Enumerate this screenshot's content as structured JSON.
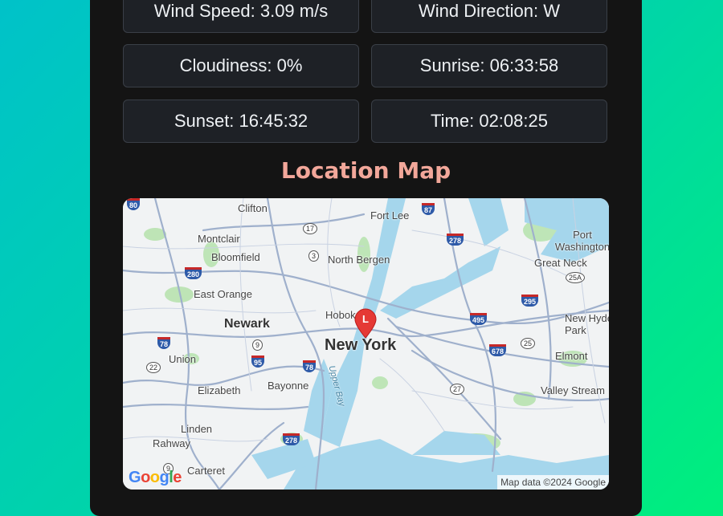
{
  "weather": {
    "wind_speed": "Wind Speed: 3.09 m/s",
    "wind_direction": "Wind Direction: W",
    "cloudiness": "Cloudiness: 0%",
    "sunrise": "Sunrise: 06:33:58",
    "sunset": "Sunset: 16:45:32",
    "time": "Time: 02:08:25"
  },
  "map_section": {
    "title": "Location Map",
    "marker_label": "L",
    "attribution": "Map data ©2024 Google",
    "labels": {
      "clifton": "Clifton",
      "fort_lee": "Fort Lee",
      "montclair": "Montclair",
      "port_washington": "Port Washington",
      "bloomfield": "Bloomfield",
      "north_bergen": "North Bergen",
      "great_neck": "Great Neck",
      "east_orange": "East Orange",
      "hoboken": "Hobok",
      "newark": "Newark",
      "new_hyde_park": "New Hyde Park",
      "new_york": "New York",
      "union": "Union",
      "elmont": "Elmont",
      "elizabeth": "Elizabeth",
      "bayonne": "Bayonne",
      "valley_stream": "Valley Stream",
      "upper_bay": "Upper Bay",
      "linden": "Linden",
      "rahway": "Rahway",
      "carteret": "Carteret"
    },
    "shields": {
      "i80": "80",
      "i87": "87",
      "i278a": "278",
      "i280": "280",
      "i495": "495",
      "i295": "295",
      "i78a": "78",
      "i95": "95",
      "i78b": "78",
      "i678": "678",
      "i278b": "278"
    },
    "routes": {
      "r17": "17",
      "r3": "3",
      "r25a": "25A",
      "r9": "9",
      "r25": "25",
      "r22": "22",
      "r27": "27",
      "r9b": "9"
    }
  },
  "colors": {
    "card_bg": "#141414",
    "tile_bg": "#1e2126",
    "title": "#f2a79a",
    "water": "#a5d6ec",
    "park": "#b8e3b0",
    "marker": "#e53935"
  }
}
